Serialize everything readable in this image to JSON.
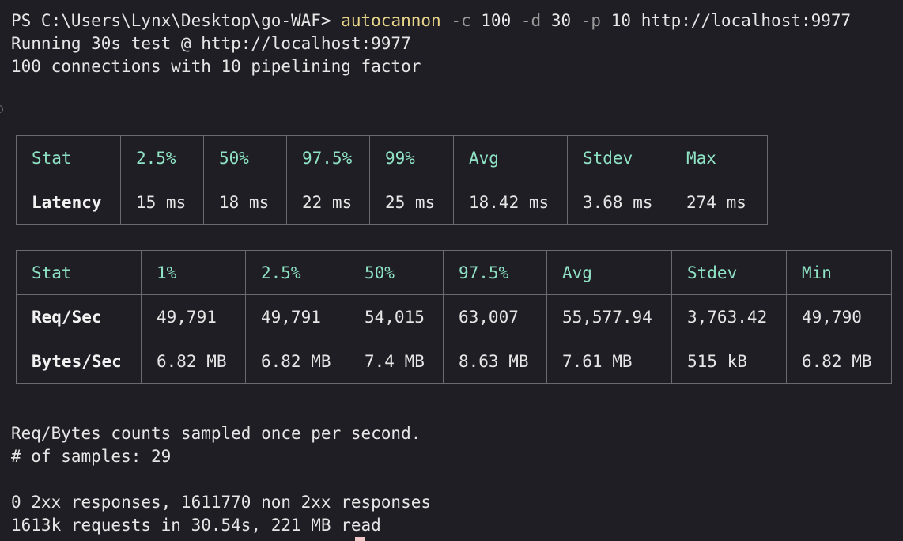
{
  "terminal": {
    "prompt": "PS C:\\Users\\Lynx\\Desktop\\go-WAF> ",
    "command": "autocannon",
    "args": [
      {
        "flag": "-c",
        "value": "100"
      },
      {
        "flag": "-d",
        "value": "30"
      },
      {
        "flag": "-p",
        "value": "10"
      }
    ],
    "url": "http://localhost:9977",
    "running": "Running 30s test @ http://localhost:9977",
    "connections": "100 connections with 10 pipelining factor"
  },
  "latency_table": {
    "headers": [
      "Stat",
      "2.5%",
      "50%",
      "97.5%",
      "99%",
      "Avg",
      "Stdev",
      "Max"
    ],
    "rows": [
      [
        "Latency",
        "15 ms",
        "18 ms",
        "22 ms",
        "25 ms",
        "18.42 ms",
        "3.68 ms",
        "274 ms"
      ]
    ]
  },
  "throughput_table": {
    "headers": [
      "Stat",
      "1%",
      "2.5%",
      "50%",
      "97.5%",
      "Avg",
      "Stdev",
      "Min"
    ],
    "rows": [
      [
        "Req/Sec",
        "49,791",
        "49,791",
        "54,015",
        "63,007",
        "55,577.94",
        "3,763.42",
        "49,790"
      ],
      [
        "Bytes/Sec",
        "6.82 MB",
        "6.82 MB",
        "7.4 MB",
        "8.63 MB",
        "7.61 MB",
        "515 kB",
        "6.82 MB"
      ]
    ]
  },
  "summary": {
    "sampling": "Req/Bytes counts sampled once per second.",
    "samples": "# of samples: 29",
    "responses": "0 2xx responses, 1611770 non 2xx responses",
    "totals": "1613k requests in 30.54s, 221 MB read"
  },
  "colors": {
    "background": "#1e1e24",
    "text": "#e6e6e6",
    "command": "#e8d58a",
    "header": "#8fe3c4",
    "border": "#6a6a72"
  }
}
